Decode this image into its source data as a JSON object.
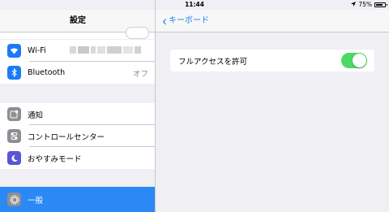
{
  "status": {
    "device": "iPad",
    "wifi_icon": "wifi-icon",
    "time": "11:44",
    "battery": "75%",
    "battery_level": 0.75
  },
  "sidebar": {
    "title": "設定",
    "items": [
      {
        "label": "Wi-Fi",
        "icon": "wifi-icon",
        "color": "#1a7cf5"
      },
      {
        "label": "Bluetooth",
        "value": "オフ",
        "icon": "bluetooth-icon",
        "color": "#1a7cf5"
      },
      {
        "label": "通知",
        "icon": "notifications-icon",
        "color": "#8e8e93"
      },
      {
        "label": "コントロールセンター",
        "icon": "control-center-icon",
        "color": "#8e8e93"
      },
      {
        "label": "おやすみモード",
        "icon": "moon-icon",
        "color": "#5856d6"
      },
      {
        "label": "一般",
        "icon": "gear-icon",
        "color": "#8e8e93",
        "selected": true
      }
    ]
  },
  "detail": {
    "back_label": "キーボード",
    "row_label": "フルアクセスを許可",
    "switch_on": true,
    "accent": "#4cd964"
  }
}
